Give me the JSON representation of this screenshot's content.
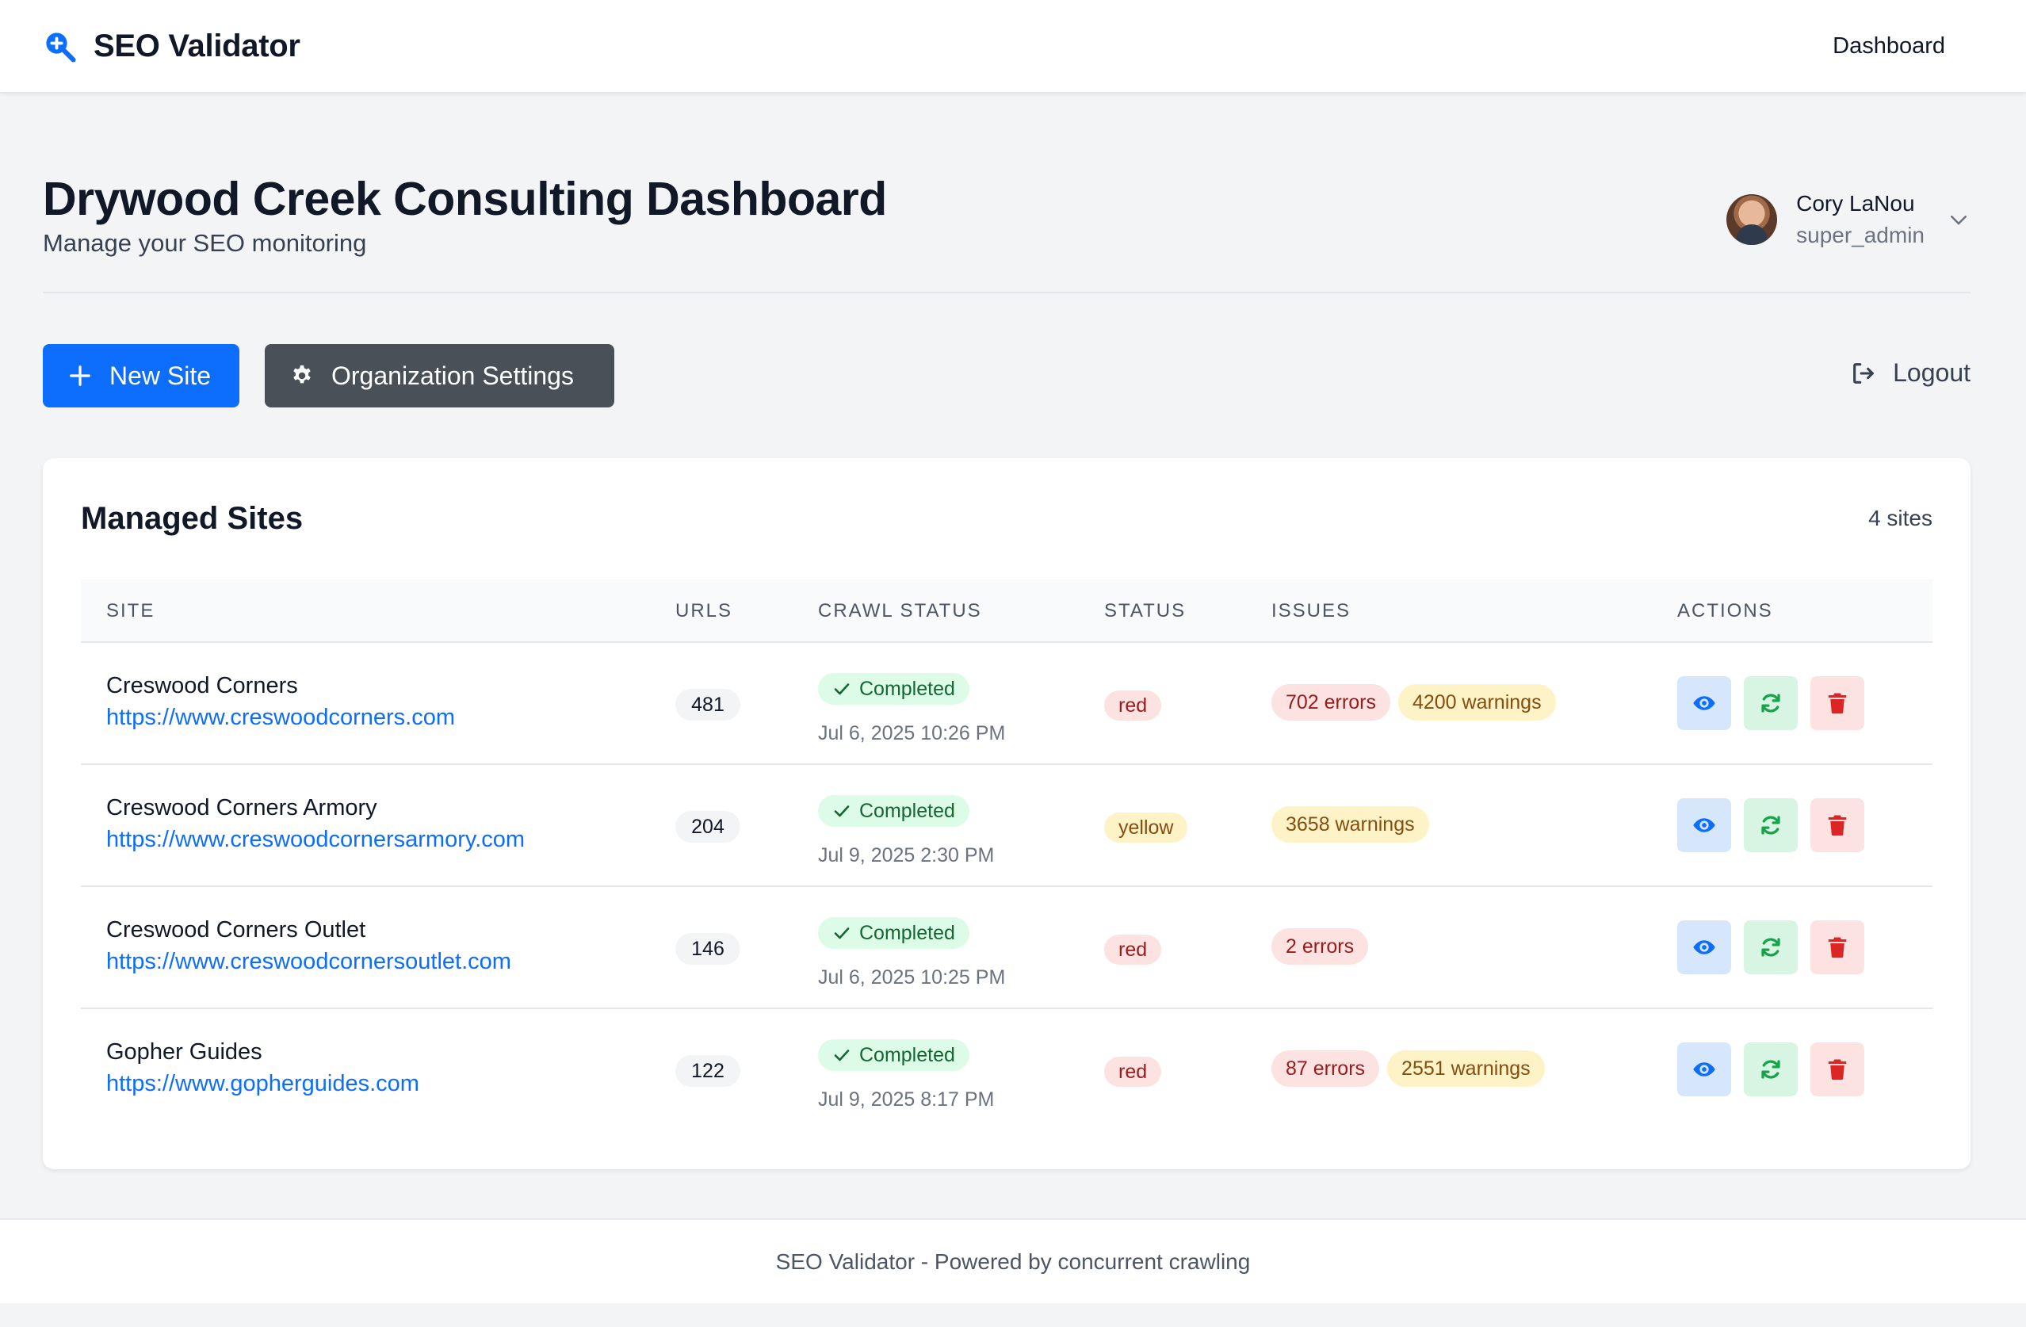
{
  "app": {
    "brand_name": "SEO Validator",
    "brand_icon": "magnifier-plus-icon",
    "nav_dashboard": "Dashboard"
  },
  "header": {
    "title": "Drywood Creek Consulting Dashboard",
    "subtitle": "Manage your SEO monitoring"
  },
  "user": {
    "name": "Cory LaNou",
    "role": "super_admin"
  },
  "toolbar": {
    "new_site_label": "New Site",
    "org_settings_label": "Organization Settings",
    "logout_label": "Logout"
  },
  "sites_card": {
    "title": "Managed Sites",
    "count_label": "4 sites",
    "columns": [
      "Site",
      "URLs",
      "Crawl Status",
      "Status",
      "Issues",
      "Actions"
    ],
    "rows": [
      {
        "name": "Creswood Corners",
        "url": "https://www.creswoodcorners.com",
        "urls": "481",
        "crawl_status": "Completed",
        "crawl_date": "Jul 6, 2025 10:26 PM",
        "status": "red",
        "errors": "702 errors",
        "warnings": "4200 warnings"
      },
      {
        "name": "Creswood Corners Armory",
        "url": "https://www.creswoodcornersarmory.com",
        "urls": "204",
        "crawl_status": "Completed",
        "crawl_date": "Jul 9, 2025 2:30 PM",
        "status": "yellow",
        "errors": "",
        "warnings": "3658 warnings"
      },
      {
        "name": "Creswood Corners Outlet",
        "url": "https://www.creswoodcornersoutlet.com",
        "urls": "146",
        "crawl_status": "Completed",
        "crawl_date": "Jul 6, 2025 10:25 PM",
        "status": "red",
        "errors": "2 errors",
        "warnings": ""
      },
      {
        "name": "Gopher Guides",
        "url": "https://www.gopherguides.com",
        "urls": "122",
        "crawl_status": "Completed",
        "crawl_date": "Jul 9, 2025 8:17 PM",
        "status": "red",
        "errors": "87 errors",
        "warnings": "2551 warnings"
      }
    ]
  },
  "footer": {
    "text": "SEO Validator - Powered by concurrent crawling"
  },
  "colors": {
    "primary": "#0d6efd",
    "dark_button": "#495057",
    "completed_bg": "#dcfce7",
    "error_bg": "#fde2e2",
    "warning_bg": "#fef3c7"
  }
}
